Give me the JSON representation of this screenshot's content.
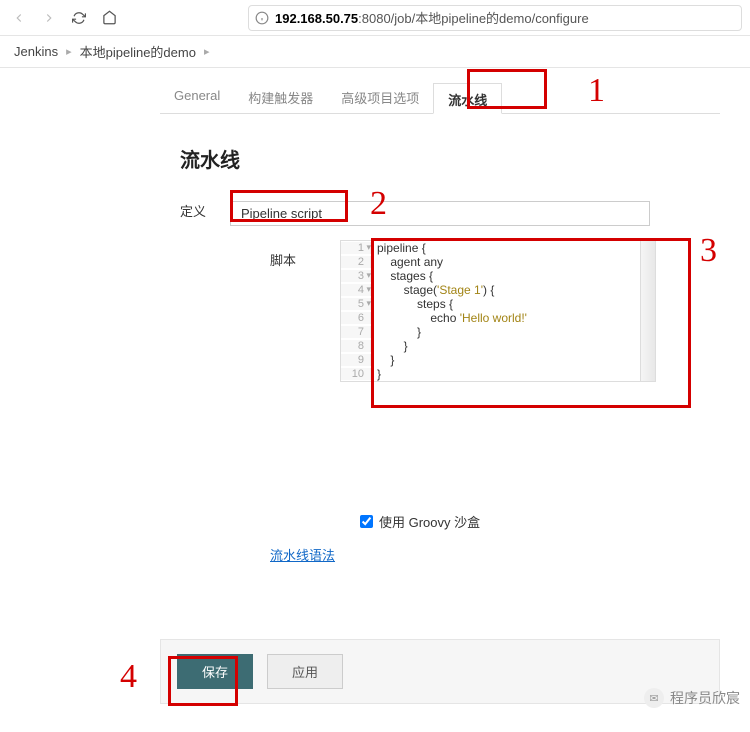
{
  "browser": {
    "url_host": "192.168.50.75",
    "url_rest": ":8080/job/本地pipeline的demo/configure"
  },
  "breadcrumb": {
    "items": [
      "Jenkins",
      "本地pipeline的demo"
    ]
  },
  "tabs": {
    "items": [
      {
        "label": "General"
      },
      {
        "label": "构建触发器"
      },
      {
        "label": "高级项目选项"
      },
      {
        "label": "流水线"
      }
    ]
  },
  "section_title": "流水线",
  "def_label": "定义",
  "def_value": "Pipeline script",
  "script_label": "脚本",
  "code": {
    "lines": [
      "pipeline {",
      "    agent any",
      "    stages {",
      "        stage('Stage 1') {",
      "            steps {",
      "                echo 'Hello world!'",
      "            }",
      "        }",
      "    }",
      "}"
    ]
  },
  "groovy_checkbox": "使用 Groovy 沙盒",
  "syntax_link": "流水线语法",
  "buttons": {
    "save": "保存",
    "apply": "应用"
  },
  "annotations": [
    "1",
    "2",
    "3",
    "4"
  ],
  "watermark": "程序员欣宸"
}
